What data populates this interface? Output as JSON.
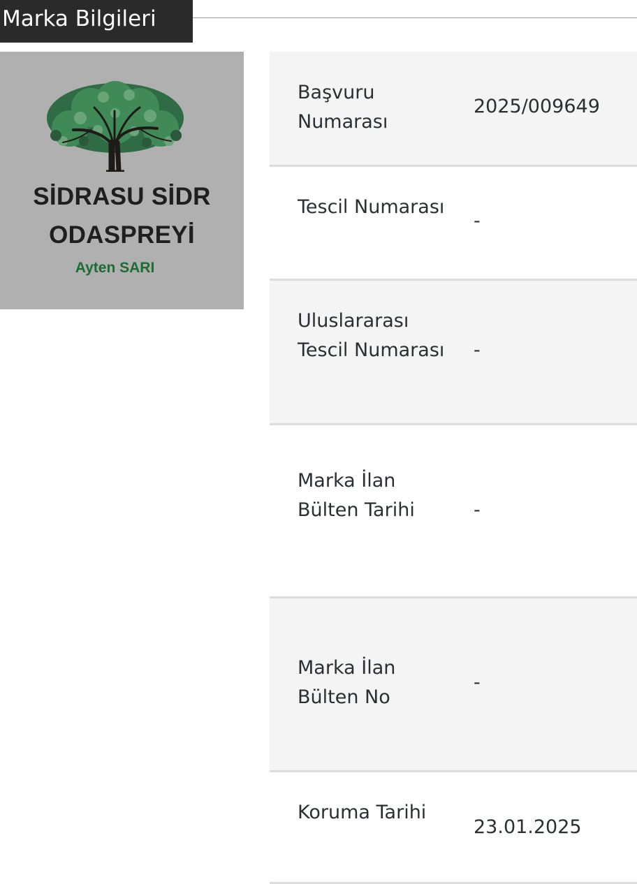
{
  "section": {
    "title": "Marka Bilgileri"
  },
  "brand": {
    "line1": "SİDRASU SİDR",
    "line2": "ODASPREYİ",
    "owner": "Ayten SARI",
    "owner_color": "#1e6b33",
    "logo_icon": "tree-icon"
  },
  "rows": [
    {
      "label": "Başvuru Numarası",
      "value": "2025/009649"
    },
    {
      "label": "Tescil Numarası",
      "value": "-"
    },
    {
      "label": "Uluslararası Tescil Numarası",
      "value": "-"
    },
    {
      "label": "Marka İlan Bülten Tarihi",
      "value": "-"
    },
    {
      "label": "Marka İlan Bülten No",
      "value": "-"
    },
    {
      "label": "Koruma Tarihi",
      "value": "23.01.2025"
    }
  ]
}
